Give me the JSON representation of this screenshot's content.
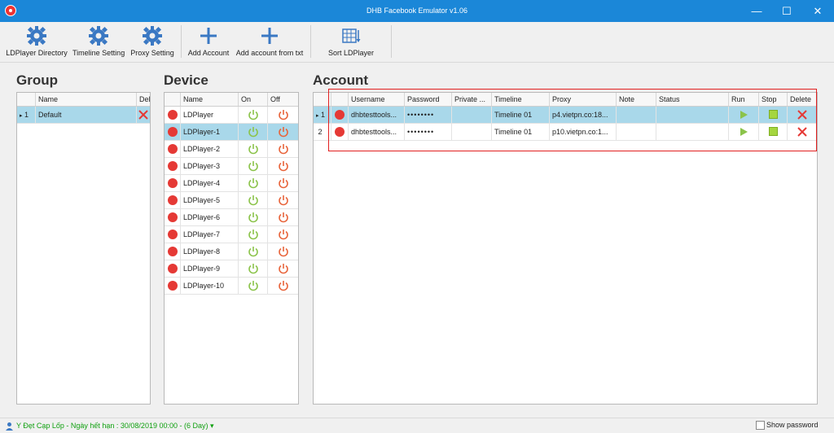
{
  "window": {
    "title": "DHB Facebook Emulator v1.06",
    "min": "—",
    "max": "☐",
    "close": "✕"
  },
  "toolbar": {
    "ldplayer_directory": "LDPlayer Directory",
    "timeline_setting": "Timeline Setting",
    "proxy_setting": "Proxy Setting",
    "add_account": "Add Account",
    "add_account_txt": "Add account from txt",
    "sort_ldplayer": "Sort LDPlayer"
  },
  "group": {
    "title": "Group",
    "columns": {
      "name": "Name",
      "delete": "Delete"
    },
    "rows": [
      {
        "num": "1",
        "name": "Default"
      }
    ]
  },
  "device": {
    "title": "Device",
    "columns": {
      "name": "Name",
      "on": "On",
      "off": "Off"
    },
    "rows": [
      "LDPlayer",
      "LDPlayer-1",
      "LDPlayer-2",
      "LDPlayer-3",
      "LDPlayer-4",
      "LDPlayer-5",
      "LDPlayer-6",
      "LDPlayer-7",
      "LDPlayer-8",
      "LDPlayer-9",
      "LDPlayer-10"
    ],
    "selected_index": 1
  },
  "account": {
    "title": "Account",
    "columns": {
      "username": "Username",
      "password": "Password",
      "private": "Private ...",
      "timeline": "Timeline",
      "proxy": "Proxy",
      "note": "Note",
      "status": "Status",
      "run": "Run",
      "stop": "Stop",
      "delete": "Delete"
    },
    "rows": [
      {
        "num": "1",
        "username": "dhbtesttools...",
        "password": "••••••••",
        "private": "",
        "timeline": "Timeline 01",
        "proxy": "p4.vietpn.co:18...",
        "note": "",
        "status": ""
      },
      {
        "num": "2",
        "username": "dhbtesttools...",
        "password": "••••••••",
        "private": "",
        "timeline": "Timeline 01",
        "proxy": "p10.vietpn.co:1...",
        "note": "",
        "status": ""
      }
    ]
  },
  "statusbar": {
    "text": "Y Đẹt Cạp Lốp - Ngày hết hạn : 30/08/2019 00:00 - (6 Day)",
    "show_password": "Show password"
  },
  "colors": {
    "titlebar": "#1b87d8",
    "selection": "#a9d8ea",
    "red": "#e53935",
    "green": "#8bc34a",
    "accent_blue": "#3a78c3"
  }
}
